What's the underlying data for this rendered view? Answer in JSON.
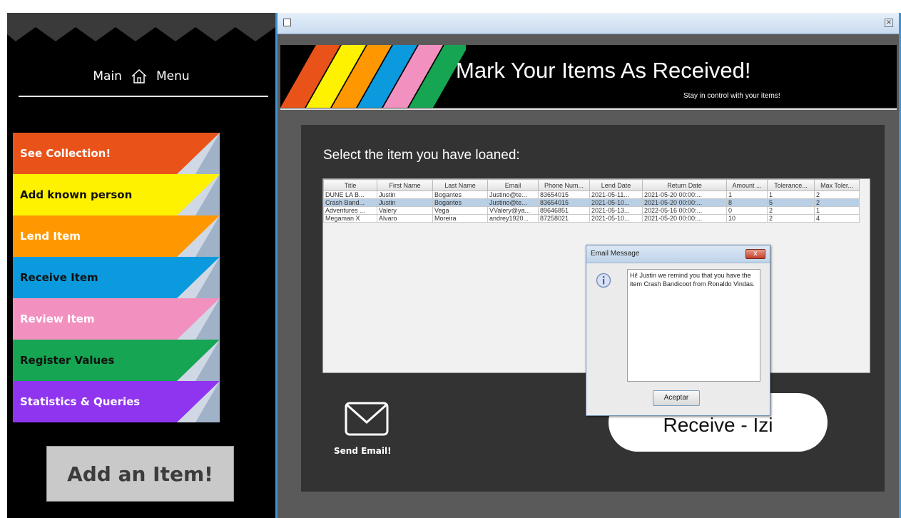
{
  "sidebar": {
    "title_left": "Main",
    "title_right": "Menu",
    "title_icon": "home-icon",
    "items": [
      {
        "label": "See Collection!",
        "bg": "#e9531a",
        "color": "#ffffff"
      },
      {
        "label": "Add known person",
        "bg": "#fff200",
        "color": "#111111"
      },
      {
        "label": "Lend Item",
        "bg": "#ff9800",
        "color": "#ffffff"
      },
      {
        "label": "Receive Item",
        "bg": "#0b9ade",
        "color": "#111111"
      },
      {
        "label": "Review Item",
        "bg": "#f291c0",
        "color": "#ffffff"
      },
      {
        "label": "Register Values",
        "bg": "#16a552",
        "color": "#111111"
      },
      {
        "label": "Statistics & Queries",
        "bg": "#8f35f0",
        "color": "#ffffff"
      }
    ],
    "add_item_label": "Add an Item!"
  },
  "window": {
    "banner_title": "Mark Your Items As Received!",
    "banner_subtitle": "Stay in control with your items!",
    "stripe_colors": [
      "#e9531a",
      "#fff200",
      "#ff9800",
      "#0b9ade",
      "#f291c0",
      "#16a552"
    ]
  },
  "main": {
    "select_label": "Select the item you have loaned:",
    "table": {
      "columns": [
        "Title",
        "First Name",
        "Last Name",
        "Email",
        "Phone Num...",
        "Lend Date",
        "Return Date",
        "Amount ...",
        "Tolerance...",
        "Max Toler..."
      ],
      "rows": [
        [
          "DUNE LA B...",
          "Justin",
          "Bogantes",
          "Justino@te...",
          "83654015",
          "2021-05-11...",
          "2021-05-20 00:00:...",
          "1",
          "1",
          "2"
        ],
        [
          "Crash Band...",
          "Justin",
          "Bogantes",
          "Justino@te...",
          "83654015",
          "2021-05-10...",
          "2021-05-20 00:00:...",
          "8",
          "5",
          "2"
        ],
        [
          "Adventures ...",
          "Valery",
          "Vega",
          "VValery@ya...",
          "89646851",
          "2021-05-13...",
          "2022-05-16 00:00:...",
          "0",
          "2",
          "1"
        ],
        [
          "Megaman X",
          "Alvaro",
          "Moreira",
          "andrey1920...",
          "87258021",
          "2021-05-10...",
          "2021-05-20 00:00:...",
          "10",
          "2",
          "4"
        ]
      ],
      "selected_row": 1
    },
    "send_email_label": "Send Email!",
    "receive_button_label": "Receive - Izi"
  },
  "dialog": {
    "title": "Email Message",
    "message": "Hi! Justin we remind you that you have the item Crash Bandicoot from Ronaldo Vindas.",
    "ok_label": "Aceptar",
    "close_label": "x"
  }
}
